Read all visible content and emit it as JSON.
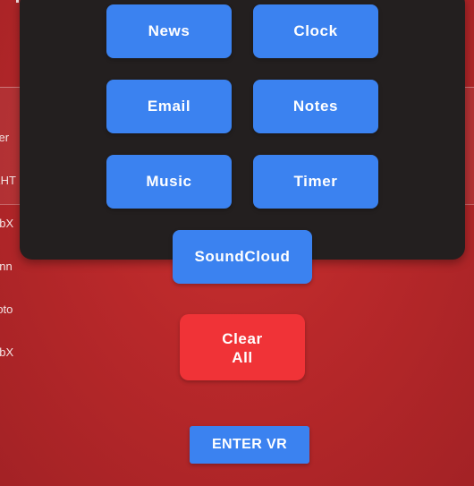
{
  "background": {
    "text_lines": [
      "ser",
      "KHT",
      "ebX",
      "unn",
      "roto",
      "ebX"
    ]
  },
  "apps": {
    "news": "News",
    "clock": "Clock",
    "email": "Email",
    "notes": "Notes",
    "music": "Music",
    "timer": "Timer",
    "soundcloud": "SoundCloud"
  },
  "actions": {
    "clear_line1": "Clear",
    "clear_line2": "All",
    "enter_vr": "ENTER VR"
  },
  "colors": {
    "background": "#b8282a",
    "panel": "#231f1f",
    "app_button": "#3b82f0",
    "clear_button": "#f03337",
    "button_text": "#ffffff"
  }
}
